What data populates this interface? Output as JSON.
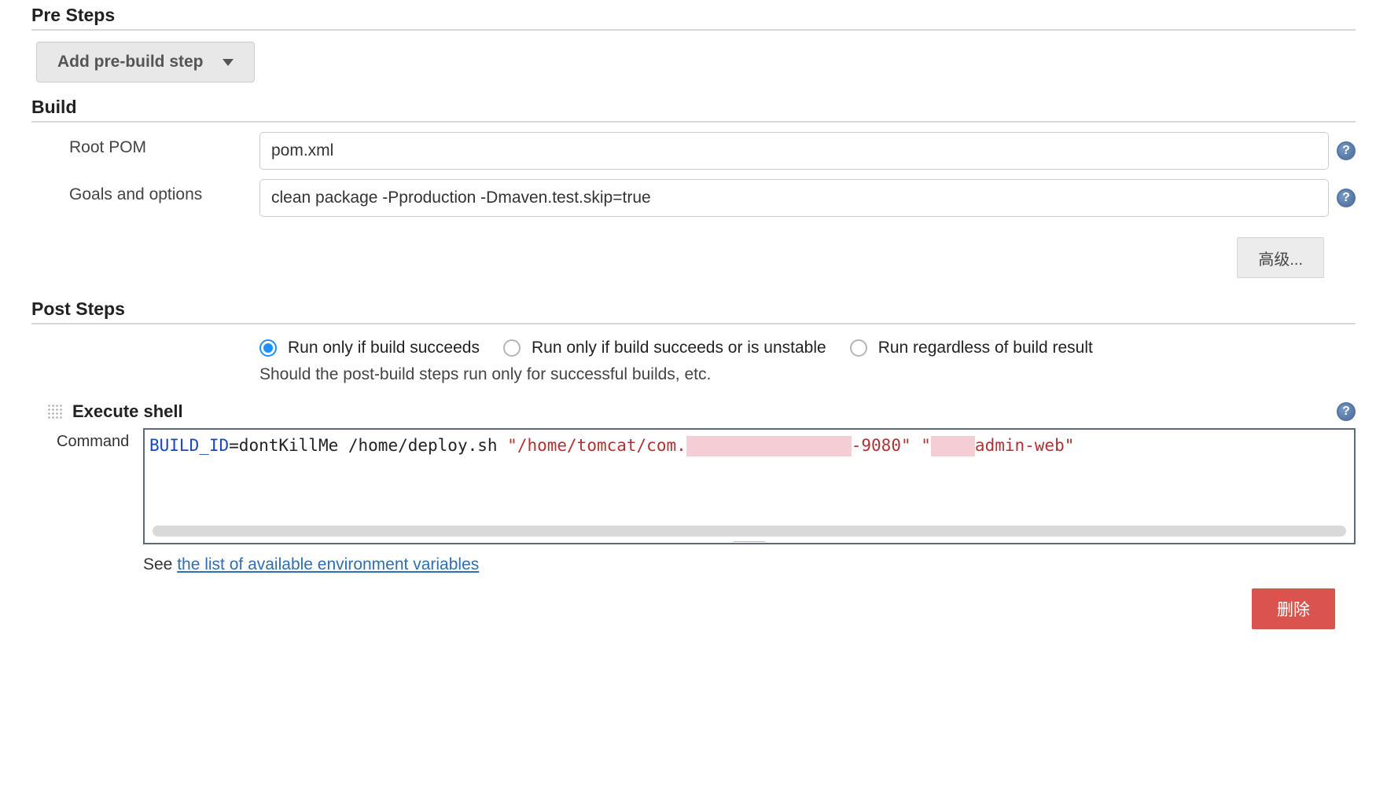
{
  "preSteps": {
    "heading": "Pre Steps",
    "addButton": "Add pre-build step"
  },
  "build": {
    "heading": "Build",
    "rootPom": {
      "label": "Root POM",
      "value": "pom.xml"
    },
    "goals": {
      "label": "Goals and options",
      "value": "clean package -Pproduction -Dmaven.test.skip=true"
    },
    "advanced": "高级..."
  },
  "postSteps": {
    "heading": "Post Steps",
    "options": {
      "succeeds": "Run only if build succeeds",
      "unstable": "Run only if build succeeds or is unstable",
      "regardless": "Run regardless of build result",
      "selected": "succeeds"
    },
    "description": "Should the post-build steps run only for successful builds, etc."
  },
  "executeShell": {
    "title": "Execute shell",
    "commandLabel": "Command",
    "command": {
      "var": "BUILD_ID",
      "assign": "=dontKillMe /home/deploy.sh ",
      "str1_prefix": "\"/home/tomcat/com.",
      "str1_suffix": "-9080\"",
      "gap": " ",
      "str2_prefix": "\"",
      "str2_suffix": "admin-web\""
    },
    "seePrefix": "See ",
    "link": "the list of available environment variables",
    "deleteBtn": "删除"
  },
  "icons": {
    "help": "?"
  }
}
